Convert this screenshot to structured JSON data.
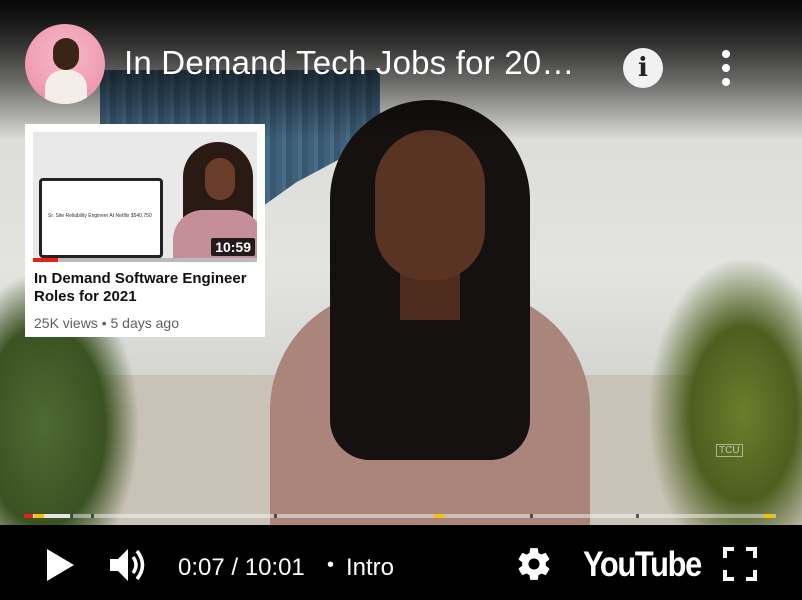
{
  "video": {
    "title": "In Demand Tech Jobs for 20…",
    "watermark": "TCU"
  },
  "end_card": {
    "duration": "10:59",
    "title": "In Demand Software Engineer Roles for 2021",
    "meta": "25K views • 5 days ago",
    "thumbnail_text": "Sr. Site Reliability Engineer At Netflix $540,750",
    "watched_fraction": 0.11
  },
  "player": {
    "time_display": "0:07 / 10:01",
    "separator": "•",
    "chapter": "Intro",
    "logo_text": "YouTube",
    "progress_fraction": 0.012,
    "buffered_fraction": 0.063
  },
  "icons": {
    "info": "info-icon",
    "more": "more-vert-icon",
    "play": "play-icon",
    "volume": "volume-icon",
    "settings": "gear-icon",
    "fullscreen": "fullscreen-icon"
  },
  "colors": {
    "accent_red": "#e62117",
    "chapter_marker_yellow": "#f4c20d"
  }
}
